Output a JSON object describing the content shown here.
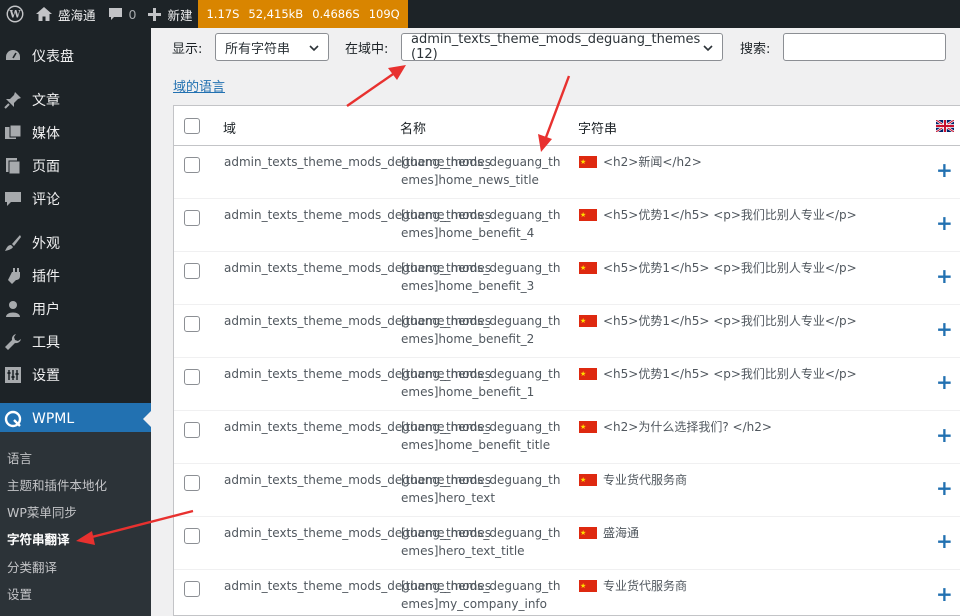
{
  "adminbar": {
    "site_name": "盛海通",
    "comment_count": "0",
    "new_label": "新建",
    "debug": [
      "1.17S",
      "52,415kB",
      "0.4686S",
      "109Q"
    ]
  },
  "sidebar": {
    "items": [
      {
        "label": "仪表盘",
        "icon": "dashboard-icon"
      },
      {
        "label": "文章",
        "icon": "pin-icon"
      },
      {
        "label": "媒体",
        "icon": "media-icon"
      },
      {
        "label": "页面",
        "icon": "page-icon"
      },
      {
        "label": "评论",
        "icon": "comment-icon"
      },
      {
        "label": "外观",
        "icon": "brush-icon"
      },
      {
        "label": "插件",
        "icon": "plugin-icon"
      },
      {
        "label": "用户",
        "icon": "user-icon"
      },
      {
        "label": "工具",
        "icon": "wrench-icon"
      },
      {
        "label": "设置",
        "icon": "settings-icon"
      }
    ],
    "wpml_label": "WPML",
    "submenu": [
      "语言",
      "主题和插件本地化",
      "WP菜单同步",
      "字符串翻译",
      "分类翻译",
      "设置"
    ]
  },
  "filters": {
    "show_label": "显示:",
    "show_value": "所有字符串",
    "domain_label": "在域中:",
    "domain_value": "admin_texts_theme_mods_deguang_themes (12)",
    "search_label": "搜索:"
  },
  "domain_lang_link": "域的语言",
  "table": {
    "headers": {
      "domain": "域",
      "name": "名称",
      "string": "字符串"
    },
    "rows": [
      {
        "domain": "admin_texts_theme_mods_deguang_themes",
        "name": "[theme_mods_deguang_themes]home_news_title",
        "string": "<h2>新闻</h2>"
      },
      {
        "domain": "admin_texts_theme_mods_deguang_themes",
        "name": "[theme_mods_deguang_themes]home_benefit_4",
        "string": "<h5>优势1</h5> <p>我们比别人专业</p>"
      },
      {
        "domain": "admin_texts_theme_mods_deguang_themes",
        "name": "[theme_mods_deguang_themes]home_benefit_3",
        "string": "<h5>优势1</h5> <p>我们比别人专业</p>"
      },
      {
        "domain": "admin_texts_theme_mods_deguang_themes",
        "name": "[theme_mods_deguang_themes]home_benefit_2",
        "string": "<h5>优势1</h5> <p>我们比别人专业</p>"
      },
      {
        "domain": "admin_texts_theme_mods_deguang_themes",
        "name": "[theme_mods_deguang_themes]home_benefit_1",
        "string": "<h5>优势1</h5> <p>我们比别人专业</p>"
      },
      {
        "domain": "admin_texts_theme_mods_deguang_themes",
        "name": "[theme_mods_deguang_themes]home_benefit_title",
        "string": "<h2>为什么选择我们? </h2>"
      },
      {
        "domain": "admin_texts_theme_mods_deguang_themes",
        "name": "[theme_mods_deguang_themes]hero_text",
        "string": "专业货代服务商"
      },
      {
        "domain": "admin_texts_theme_mods_deguang_themes",
        "name": "[theme_mods_deguang_themes]hero_text_title",
        "string": "盛海通"
      },
      {
        "domain": "admin_texts_theme_mods_deguang_themes",
        "name": "[theme_mods_deguang_themes]my_company_info",
        "string": "专业货代服务商"
      }
    ]
  },
  "colors": {
    "accent": "#2271b1",
    "adminbar": "#1d2327",
    "debug": "#d98500",
    "annotation": "#e8312f"
  }
}
